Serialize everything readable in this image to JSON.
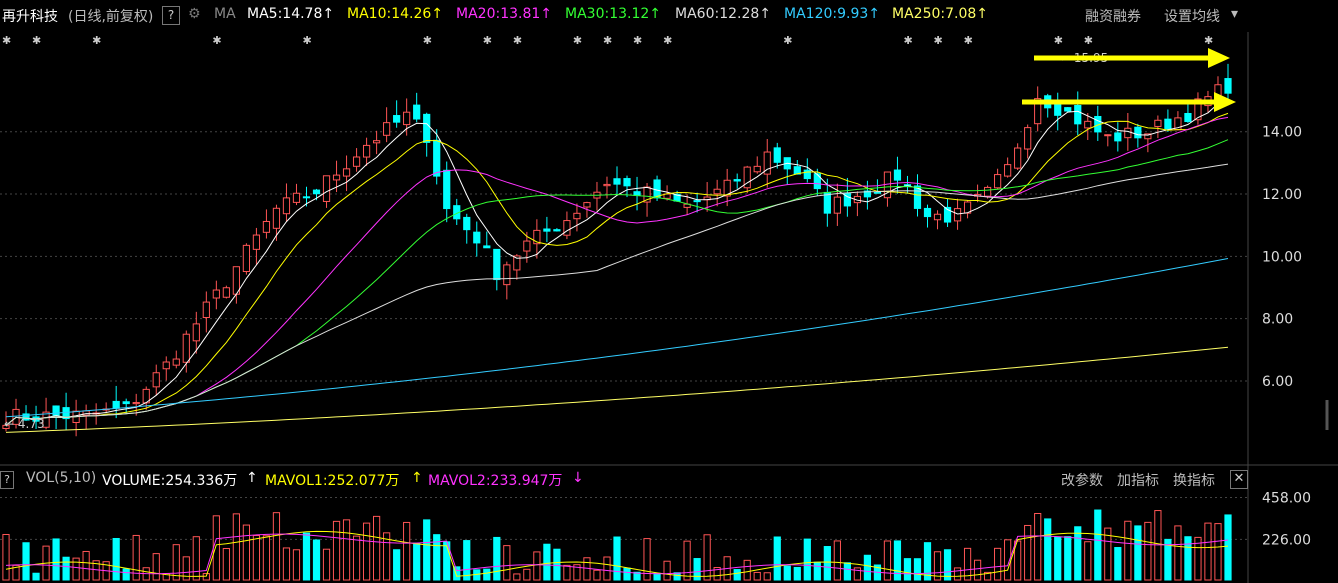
{
  "header": {
    "stock_name": "再升科技",
    "mode": "(日线,前复权)",
    "help": "?",
    "ma_label": "MA",
    "ma_items": [
      {
        "label": "MA5:14.78",
        "arrow": "↑",
        "color": "#ffffff"
      },
      {
        "label": "MA10:14.26",
        "arrow": "↑",
        "color": "#ffff00"
      },
      {
        "label": "MA20:13.81",
        "arrow": "↑",
        "color": "#ff33ff"
      },
      {
        "label": "MA30:13.12",
        "arrow": "↑",
        "color": "#33ff33"
      },
      {
        "label": "MA60:12.28",
        "arrow": "↑",
        "color": "#dddddd"
      },
      {
        "label": "MA120:9.93",
        "arrow": "↑",
        "color": "#33ccff"
      },
      {
        "label": "MA250:7.08",
        "arrow": "↑",
        "color": "#ffff66"
      }
    ],
    "rzrq": "融资融券",
    "settings": "设置均线",
    "settings_arrow": "▾"
  },
  "volume_header": {
    "help": "?",
    "label": "VOL(5,10)",
    "volume": "VOLUME:254.336万",
    "volume_arrow": "↑",
    "mavol1": "MAVOL1:252.077万",
    "mavol1_arrow": "↑",
    "mavol2": "MAVOL2:233.947万",
    "mavol2_arrow": "↓",
    "change_params": "改参数",
    "add_indicator": "加指标",
    "switch_indicator": "换指标",
    "close": "✕"
  },
  "chart_data": {
    "type": "candlestick",
    "price_axis": {
      "ticks": [
        "14.00",
        "12.00",
        "10.00",
        "8.00",
        "6.00"
      ],
      "values": [
        14,
        12,
        10,
        8,
        6
      ],
      "ylim": [
        3.4,
        17.2
      ]
    },
    "volume_axis": {
      "ticks": [
        "458.00",
        "226.00"
      ],
      "values": [
        458,
        226
      ],
      "ylim": [
        0,
        500
      ]
    },
    "annotations": {
      "high_label": "15.95",
      "low_label": "4.73"
    },
    "colors": {
      "up": "#ff5555",
      "down": "#00ffff",
      "grid": "#444444"
    }
  }
}
